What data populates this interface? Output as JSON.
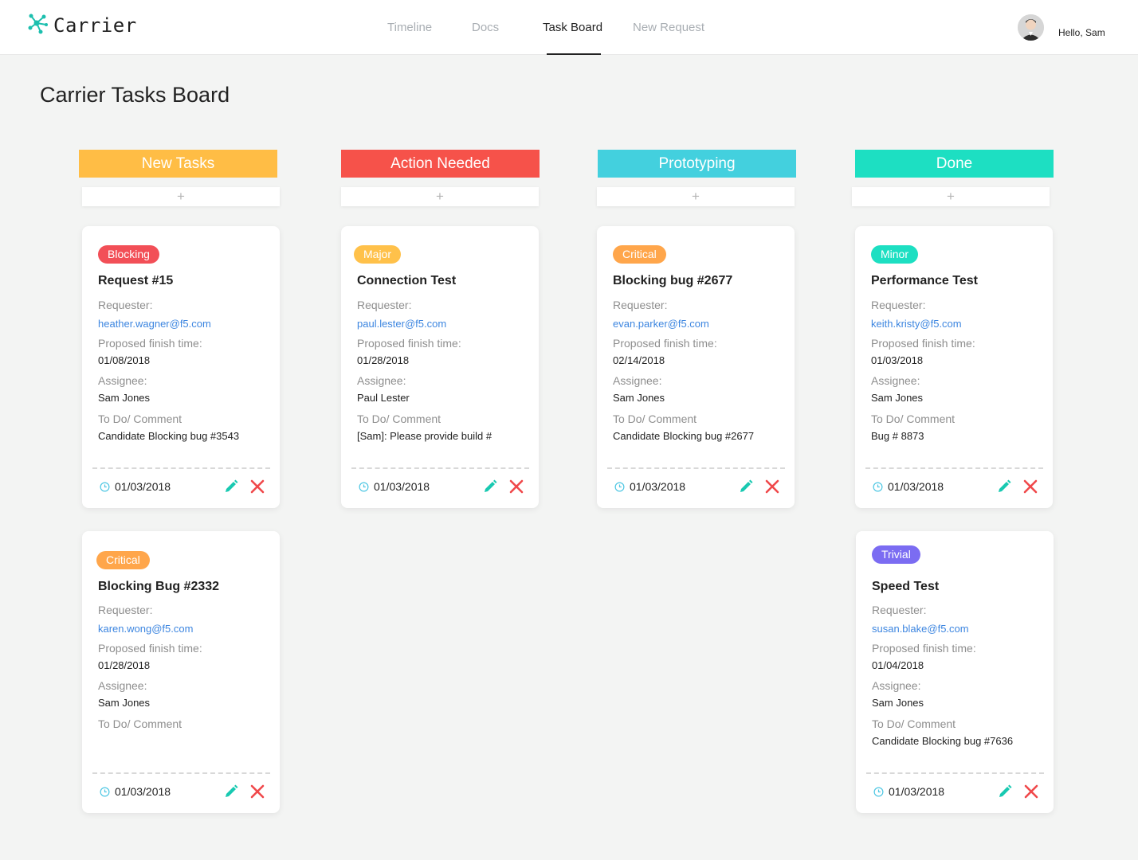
{
  "app": {
    "name": "Carrier",
    "greeting": "Hello, Sam"
  },
  "nav": {
    "items": [
      {
        "label": "Timeline",
        "active": false
      },
      {
        "label": "Docs",
        "active": false
      },
      {
        "label": "Task Board",
        "active": true
      },
      {
        "label": "New Request",
        "active": false
      }
    ]
  },
  "page": {
    "title": "Carrier Tasks Board"
  },
  "labels": {
    "requester": "Requester:",
    "finish": "Proposed finish time:",
    "assignee": "Assignee:",
    "comment": "To Do/ Comment",
    "add": "+"
  },
  "colors": {
    "new": "#ffbd45",
    "action": "#f6524a",
    "proto": "#43d0de",
    "done": "#1ddfc2",
    "blocking": "#f24f57",
    "major": "#ffc14a",
    "critical": "#ffa64b",
    "minor": "#1ddfc2",
    "trivial": "#7b6cf2",
    "edit": "#18c9b1",
    "delete": "#f0484a",
    "clock": "#4fc7e3"
  },
  "columns": [
    {
      "title": "New Tasks",
      "cards": [
        {
          "badge": "Blocking",
          "title": "Request #15",
          "requester": "heather.wagner@f5.com",
          "finish": "01/08/2018",
          "assignee": "Sam Jones",
          "comment": "Candidate Blocking bug #3543",
          "date": "01/03/2018"
        },
        {
          "badge": "Critical",
          "title": "Blocking Bug #2332",
          "requester": "karen.wong@f5.com",
          "finish": "01/28/2018",
          "assignee": "Sam Jones",
          "comment": "",
          "date": "01/03/2018"
        }
      ]
    },
    {
      "title": "Action Needed",
      "cards": [
        {
          "badge": "Major",
          "title": "Connection Test",
          "requester": "paul.lester@f5.com",
          "finish": "01/28/2018",
          "assignee": "Paul Lester",
          "comment": "[Sam]: Please provide build #",
          "date": "01/03/2018"
        }
      ]
    },
    {
      "title": "Prototyping",
      "cards": [
        {
          "badge": "Critical",
          "title": "Blocking bug #2677",
          "requester": "evan.parker@f5.com",
          "finish": "02/14/2018",
          "assignee": "Sam Jones",
          "comment": "Candidate Blocking bug #2677",
          "date": "01/03/2018"
        }
      ]
    },
    {
      "title": "Done",
      "cards": [
        {
          "badge": "Minor",
          "title": "Performance Test",
          "requester": "keith.kristy@f5.com",
          "finish": "01/03/2018",
          "assignee": "Sam Jones",
          "comment": "Bug # 8873",
          "date": "01/03/2018"
        },
        {
          "badge": "Trivial",
          "title": "Speed Test",
          "requester": "susan.blake@f5.com",
          "finish": "01/04/2018",
          "assignee": "Sam Jones",
          "comment": "Candidate Blocking bug #7636",
          "date": "01/03/2018"
        }
      ]
    }
  ]
}
